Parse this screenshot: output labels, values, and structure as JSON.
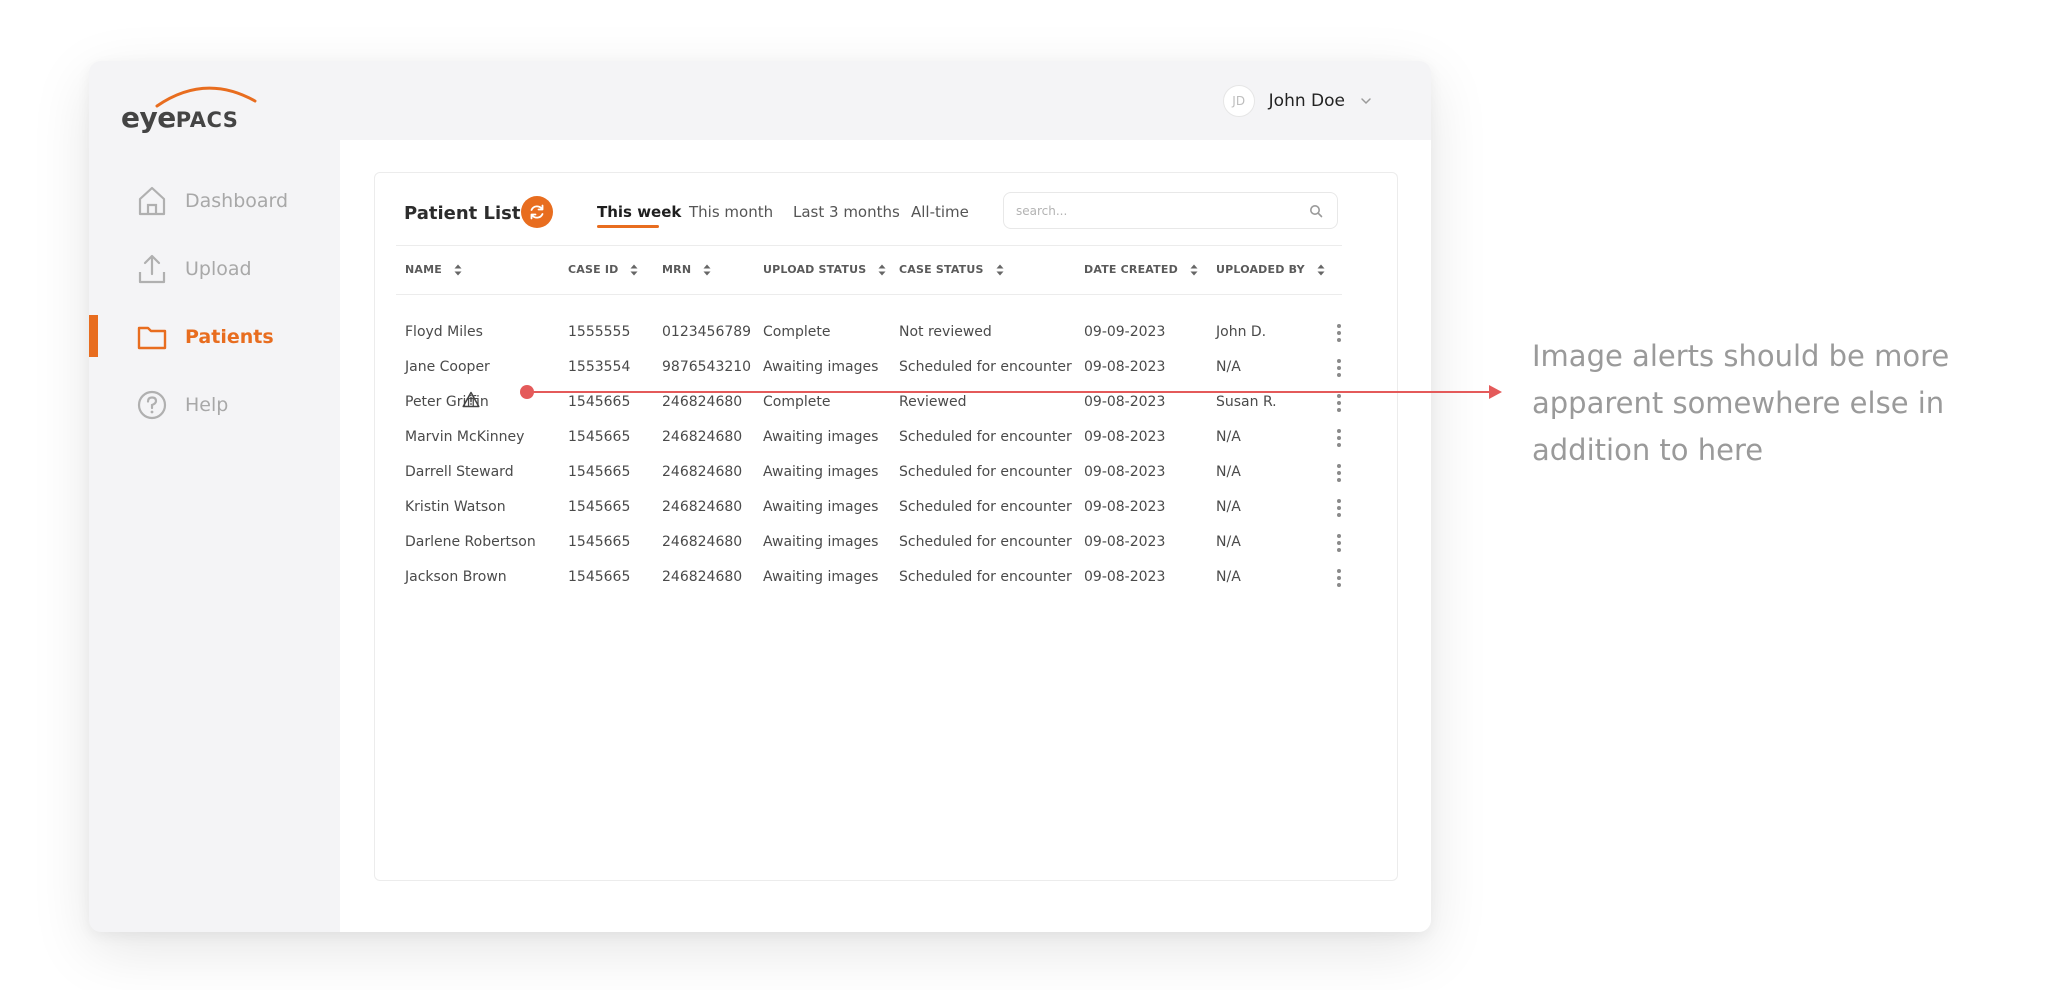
{
  "app": {
    "logo_eye": "eye",
    "logo_pacs": "PACS",
    "colors": {
      "accent": "#e86d1f",
      "annotation": "#e45a5a",
      "sidebar_bg": "#f4f4f6"
    }
  },
  "header": {
    "user_initials": "JD",
    "user_name": "John Doe"
  },
  "sidebar": {
    "items": [
      {
        "label": "Dashboard",
        "icon": "home-icon",
        "active": false
      },
      {
        "label": "Upload",
        "icon": "upload-icon",
        "active": false
      },
      {
        "label": "Patients",
        "icon": "folder-icon",
        "active": true
      },
      {
        "label": "Help",
        "icon": "help-icon",
        "active": false
      }
    ]
  },
  "patient_list": {
    "title": "Patient List",
    "tabs": [
      {
        "label": "This week",
        "active": true
      },
      {
        "label": "This month",
        "active": false
      },
      {
        "label": "Last 3 months",
        "active": false
      },
      {
        "label": "All-time",
        "active": false
      }
    ],
    "search_placeholder": "search...",
    "columns": [
      "NAME",
      "CASE ID",
      "MRN",
      "UPLOAD STATUS",
      "CASE STATUS",
      "DATE CREATED",
      "UPLOADED BY"
    ],
    "rows": [
      {
        "name": "Floyd Miles",
        "case_id": "1555555",
        "mrn": "0123456789",
        "upload_status": "Complete",
        "case_status": "Not reviewed",
        "date_created": "09-09-2023",
        "uploaded_by": "John D.",
        "alert": false
      },
      {
        "name": "Jane Cooper",
        "case_id": "1553554",
        "mrn": "9876543210",
        "upload_status": "Awaiting images",
        "case_status": "Scheduled for encounter",
        "date_created": "09-08-2023",
        "uploaded_by": "N/A",
        "alert": false
      },
      {
        "name": "Peter Griffin",
        "case_id": "1545665",
        "mrn": "246824680",
        "upload_status": "Complete",
        "case_status": "Reviewed",
        "date_created": "09-08-2023",
        "uploaded_by": "Susan R.",
        "alert": true
      },
      {
        "name": "Marvin McKinney",
        "case_id": "1545665",
        "mrn": "246824680",
        "upload_status": "Awaiting images",
        "case_status": "Scheduled for encounter",
        "date_created": "09-08-2023",
        "uploaded_by": "N/A",
        "alert": false
      },
      {
        "name": "Darrell Steward",
        "case_id": "1545665",
        "mrn": "246824680",
        "upload_status": "Awaiting images",
        "case_status": "Scheduled for encounter",
        "date_created": "09-08-2023",
        "uploaded_by": "N/A",
        "alert": false
      },
      {
        "name": "Kristin Watson",
        "case_id": "1545665",
        "mrn": "246824680",
        "upload_status": "Awaiting images",
        "case_status": "Scheduled for encounter",
        "date_created": "09-08-2023",
        "uploaded_by": "N/A",
        "alert": false
      },
      {
        "name": "Darlene Robertson",
        "case_id": "1545665",
        "mrn": "246824680",
        "upload_status": "Awaiting images",
        "case_status": "Scheduled for encounter",
        "date_created": "09-08-2023",
        "uploaded_by": "N/A",
        "alert": false
      },
      {
        "name": "Jackson Brown",
        "case_id": "1545665",
        "mrn": "246824680",
        "upload_status": "Awaiting images",
        "case_status": "Scheduled for encounter",
        "date_created": "09-08-2023",
        "uploaded_by": "N/A",
        "alert": false
      }
    ]
  },
  "annotation": {
    "text": "Image alerts should be more apparent somewhere else in addition to here"
  }
}
